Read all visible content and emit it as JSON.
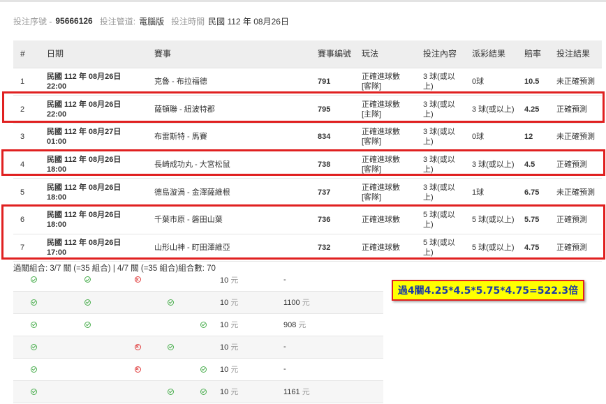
{
  "info": {
    "serial_label": "投注序號 -",
    "serial_value": "95666126",
    "channel_label": "投注管道:",
    "channel_value": "電腦版",
    "time_label": "投注時間",
    "time_value": "民國 112 年 08月26日"
  },
  "table": {
    "headers": [
      "#",
      "日期",
      "賽事",
      "賽事編號",
      "玩法",
      "投注內容",
      "派彩結果",
      "賠率",
      "投注結果"
    ],
    "rows": [
      {
        "no": "1",
        "date": "民國 112 年 08月26日",
        "time": "22:00",
        "match": "克魯 - 布拉福德",
        "event_id": "791",
        "play": "正確進球數",
        "play_sub": "[客隊]",
        "bet": "3 球(或以上)",
        "result": "0球",
        "odds": "10.5",
        "outcome": "未正確預測"
      },
      {
        "no": "2",
        "date": "民國 112 年 08月26日",
        "time": "22:00",
        "match": "薩頓聯 - 紐波特郡",
        "event_id": "795",
        "play": "正確進球數",
        "play_sub": "[主隊]",
        "bet": "3 球(或以上)",
        "result": "3 球(或以上)",
        "odds": "4.25",
        "outcome": "正確預測"
      },
      {
        "no": "3",
        "date": "民國 112 年 08月27日",
        "time": "01:00",
        "match": "布雷斯特 - 馬賽",
        "event_id": "834",
        "play": "正確進球數",
        "play_sub": "[客隊]",
        "bet": "3 球(或以上)",
        "result": "0球",
        "odds": "12",
        "outcome": "未正確預測"
      },
      {
        "no": "4",
        "date": "民國 112 年 08月26日",
        "time": "18:00",
        "match": "長崎成功丸 - 大宮松鼠",
        "event_id": "738",
        "play": "正確進球數",
        "play_sub": "[客隊]",
        "bet": "3 球(或以上)",
        "result": "3 球(或以上)",
        "odds": "4.5",
        "outcome": "正確預測"
      },
      {
        "no": "5",
        "date": "民國 112 年 08月26日",
        "time": "18:00",
        "match": "德島漩渦 - 金澤薩維根",
        "event_id": "737",
        "play": "正確進球數",
        "play_sub": "[客隊]",
        "bet": "3 球(或以上)",
        "result": "1球",
        "odds": "6.75",
        "outcome": "未正確預測"
      },
      {
        "no": "6",
        "date": "民國 112 年 08月26日",
        "time": "18:00",
        "match": "千葉市原 - 磐田山葉",
        "event_id": "736",
        "play": "正確進球數",
        "play_sub": "",
        "bet": "5 球(或以上)",
        "result": "5 球(或以上)",
        "odds": "5.75",
        "outcome": "正確預測"
      },
      {
        "no": "7",
        "date": "民國 112 年 08月26日",
        "time": "17:00",
        "match": "山形山神 - 町田澤維亞",
        "event_id": "732",
        "play": "正確進球數",
        "play_sub": "",
        "bet": "5 球(或以上)",
        "result": "5 球(或以上)",
        "odds": "4.75",
        "outcome": "正確預測"
      }
    ]
  },
  "combos": {
    "title": "過關組合: 3/7 關 (=35 組合) | 4/7 關 (=35 組合)組合數: 70",
    "unit": "元",
    "rows": [
      {
        "marks": [
          "ok",
          "ok",
          "no",
          "",
          ""
        ],
        "amount": "10",
        "payout": "-",
        "payout_unit": ""
      },
      {
        "marks": [
          "ok",
          "ok",
          "",
          "ok",
          ""
        ],
        "amount": "10",
        "payout": "1100",
        "payout_unit": "元"
      },
      {
        "marks": [
          "ok",
          "ok",
          "",
          "",
          "ok"
        ],
        "amount": "10",
        "payout": "908",
        "payout_unit": "元"
      },
      {
        "marks": [
          "ok",
          "",
          "no",
          "ok",
          ""
        ],
        "amount": "10",
        "payout": "-",
        "payout_unit": ""
      },
      {
        "marks": [
          "ok",
          "",
          "no",
          "",
          "ok"
        ],
        "amount": "10",
        "payout": "-",
        "payout_unit": ""
      },
      {
        "marks": [
          "ok",
          "",
          "",
          "ok",
          "ok"
        ],
        "amount": "10",
        "payout": "1161",
        "payout_unit": "元"
      }
    ]
  },
  "callout": {
    "text": "過4關4.25*4.5*5.75*4.75=522.3倍"
  },
  "colors": {
    "highlight_border": "#e02020",
    "callout_bg": "#ffff00",
    "callout_text": "#1a3aa6",
    "win_icon": "#4caf50",
    "lose_icon": "#e04040",
    "header_bg": "#eeeeee"
  },
  "icons": {
    "ok": "check-circle-icon",
    "no": "x-circle-icon"
  }
}
